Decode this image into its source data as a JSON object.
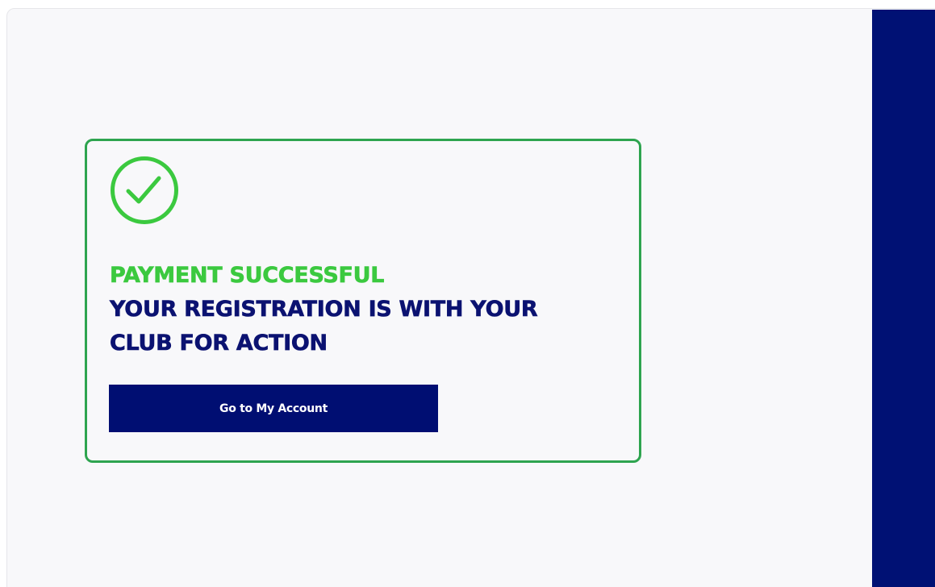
{
  "colors": {
    "panel_background": "#f8f8fa",
    "card_border": "#2ea44f",
    "success_green": "#3bc93f",
    "brand_navy": "#0b1271",
    "side_panel_navy": "#001174",
    "button_background": "#000e72",
    "button_text": "#ffffff"
  },
  "card": {
    "icon": "check-circle-icon",
    "title_success": "PAYMENT SUCCESSFUL",
    "message_line_1": "YOUR REGISTRATION IS WITH YOUR",
    "message_line_2": "CLUB FOR ACTION",
    "button_label": "Go to My Account"
  }
}
